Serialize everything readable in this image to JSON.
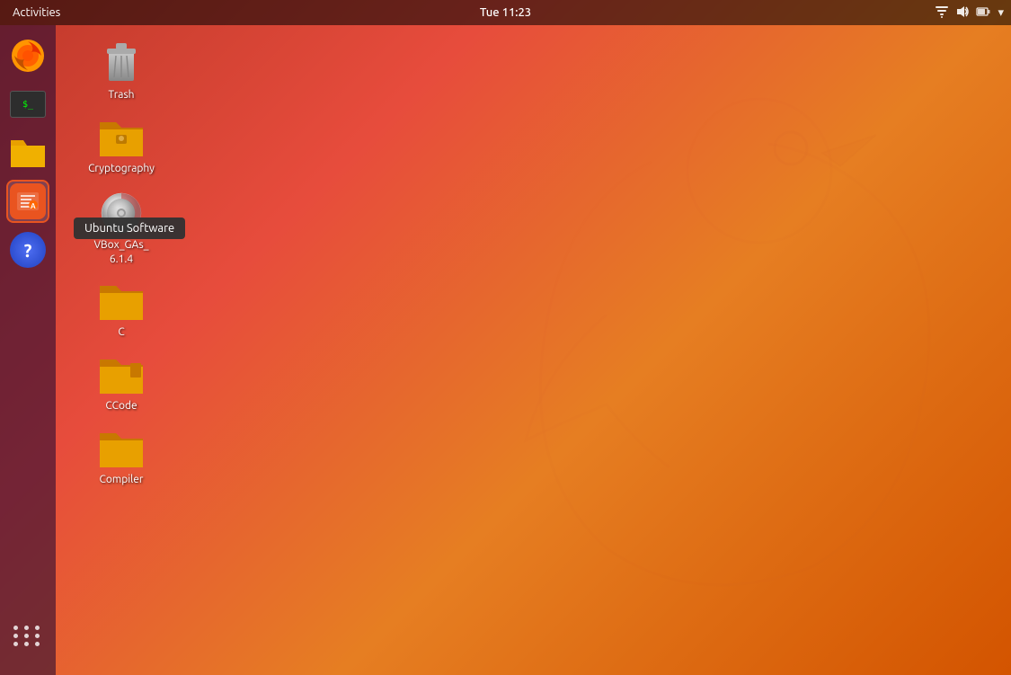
{
  "topbar": {
    "activities_label": "Activities",
    "clock": "Tue 11:23"
  },
  "dock": {
    "items": [
      {
        "name": "firefox",
        "label": "Firefox"
      },
      {
        "name": "terminal",
        "label": "Terminal"
      },
      {
        "name": "files",
        "label": "Files"
      },
      {
        "name": "ubuntu-software",
        "label": "Ubuntu Software"
      },
      {
        "name": "help",
        "label": "Help"
      }
    ],
    "apps_grid_label": "Show Applications"
  },
  "desktop": {
    "icons": [
      {
        "name": "trash",
        "label": "Trash",
        "type": "trash"
      },
      {
        "name": "cryptography",
        "label": "Cryptography",
        "type": "folder"
      },
      {
        "name": "vbox-gas",
        "label": "VBox_GAs_\n6.1.4",
        "type": "cd"
      },
      {
        "name": "c-folder",
        "label": "C",
        "type": "folder"
      },
      {
        "name": "ccode-folder",
        "label": "CCode",
        "type": "folder"
      },
      {
        "name": "compiler-folder",
        "label": "Compiler",
        "type": "folder"
      }
    ]
  },
  "tooltip": {
    "text": "Ubuntu Software"
  }
}
